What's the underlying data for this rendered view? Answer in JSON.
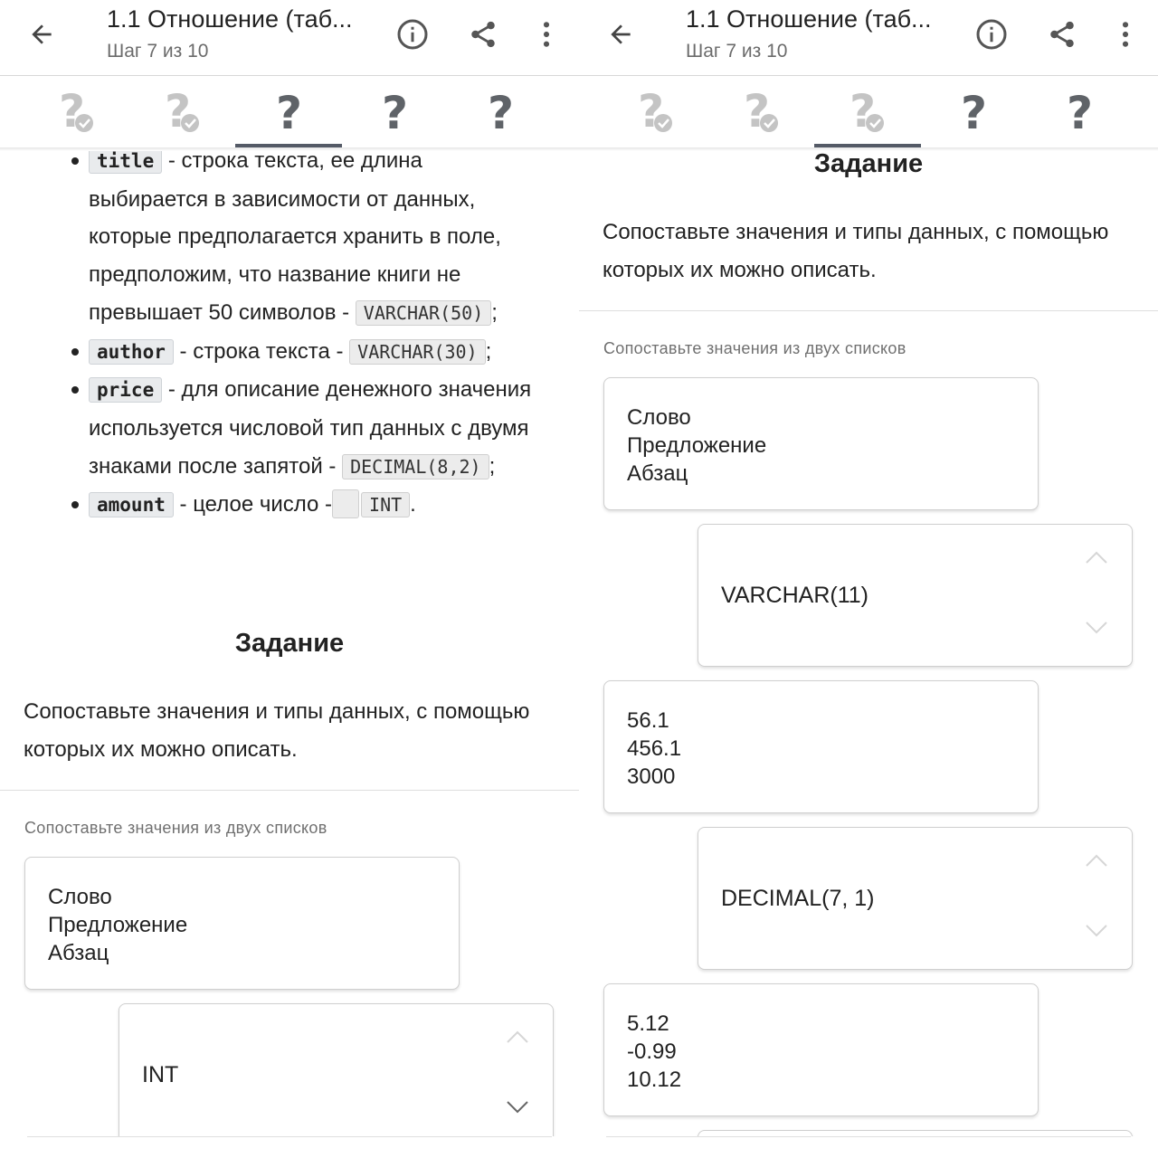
{
  "header": {
    "title": "1.1 Отношение (таб...",
    "subtitle": "Шаг 7 из 10"
  },
  "left_content": {
    "bullets": [
      {
        "keyword": "title",
        "text": " - строка текста, ее длина выбирается в зависимости от данных, которые предполагается хранить в поле, предположим, что название книги не превышает 50 символов - ",
        "type": "VARCHAR(50)",
        "end": ";"
      },
      {
        "keyword": "author",
        "text": " - строка текста - ",
        "type": "VARCHAR(30)",
        "end": ";"
      },
      {
        "keyword": "price",
        "text": " - для описание денежного значения используется числовой тип данных с двумя знаками после запятой - ",
        "type": "DECIMAL(8,2)",
        "end": ";"
      },
      {
        "keyword": "amount",
        "text": " - целое число -",
        "type": "INT",
        "end": "."
      }
    ]
  },
  "task": {
    "heading": "Задание",
    "text": "Сопоставьте значения и типы данных, с помощью которых их можно описать.",
    "hint": "Сопоставьте значения из двух списков"
  },
  "left_matching": {
    "values": [
      {
        "lines": [
          "Слово",
          "Предложение",
          "Абзац"
        ]
      }
    ],
    "types": [
      "INT"
    ]
  },
  "right_matching": {
    "values": [
      {
        "lines": [
          "Слово",
          "Предложение",
          "Абзац"
        ]
      },
      {
        "lines": [
          "56.1",
          "456.1",
          "3000"
        ]
      },
      {
        "lines": [
          "5.12",
          "-0.99",
          "10.12"
        ]
      }
    ],
    "types": [
      "VARCHAR(11)",
      "DECIMAL(7, 1)"
    ]
  },
  "colors": {
    "text": "#222222",
    "muted": "#6b6b6b",
    "active_tab_indicator": "#545a66",
    "step_icon": "#5f6368",
    "step_icon_done": "#bdbdbd",
    "card_border": "#cfcfcf"
  },
  "icons": {
    "back": "arrow-left-icon",
    "info": "info-circle-icon",
    "share": "share-icon",
    "more": "more-vertical-icon",
    "step_done": "question-check-icon",
    "step_todo": "question-icon",
    "move_up": "chevron-up-icon",
    "move_down": "chevron-down-icon"
  },
  "steps": [
    {
      "state": "done",
      "active": false
    },
    {
      "state": "done",
      "active": false
    },
    {
      "state": "todo",
      "active": true
    },
    {
      "state": "todo",
      "active": false
    },
    {
      "state": "todo",
      "active": false
    }
  ],
  "steps_right": [
    {
      "state": "done",
      "active": false
    },
    {
      "state": "done",
      "active": false
    },
    {
      "state": "done",
      "active": true
    },
    {
      "state": "todo",
      "active": false
    },
    {
      "state": "todo",
      "active": false
    }
  ]
}
